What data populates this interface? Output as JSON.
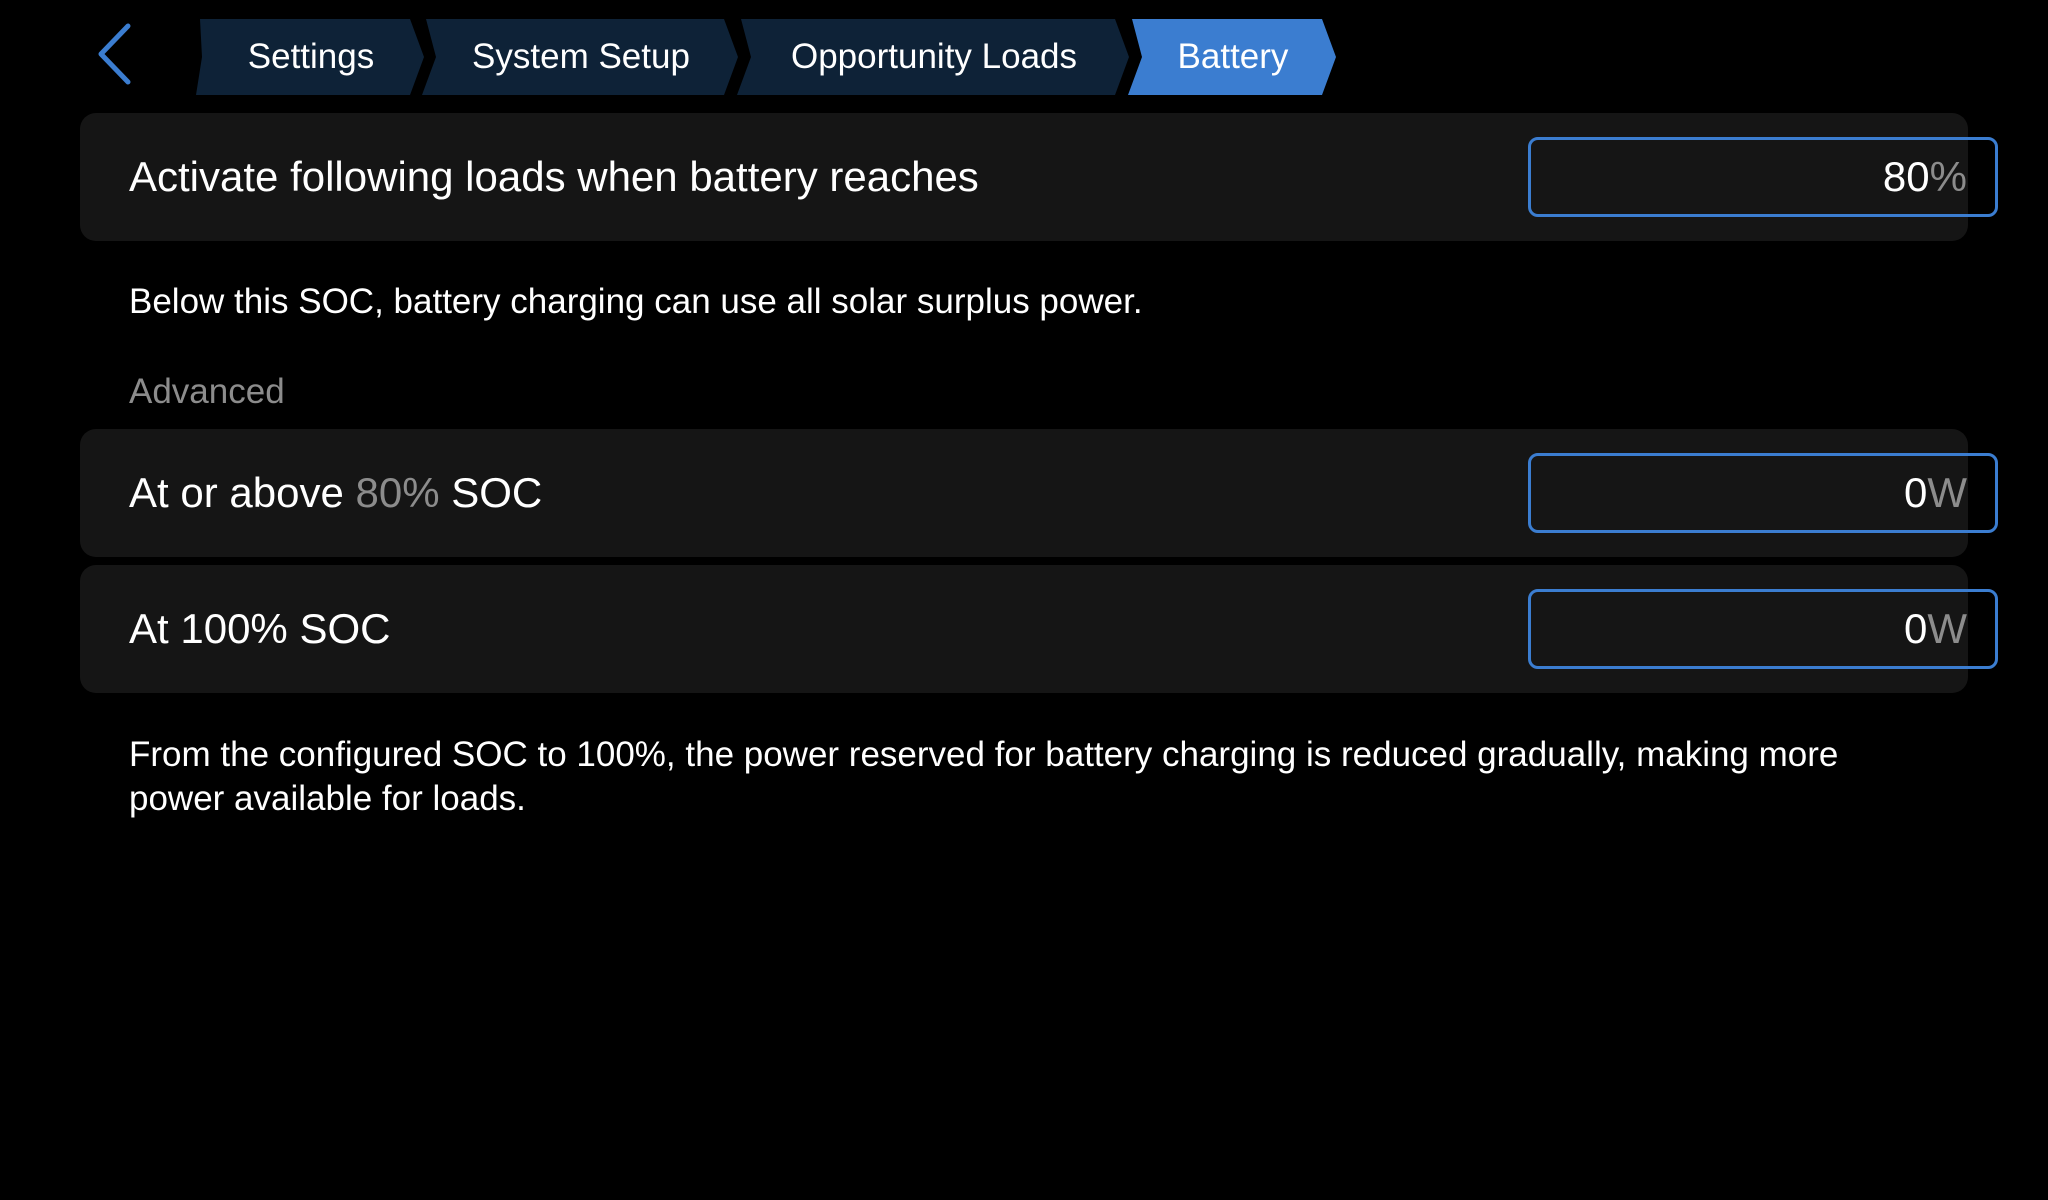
{
  "header": {
    "back_icon": "chevron-left-icon",
    "breadcrumbs": [
      {
        "label": "Settings",
        "active": false
      },
      {
        "label": "System Setup",
        "active": false
      },
      {
        "label": "Opportunity Loads",
        "active": false
      },
      {
        "label": "Battery",
        "active": true
      }
    ]
  },
  "colors": {
    "background": "#000000",
    "card": "#151515",
    "crumb_inactive": "#0e2237",
    "crumb_active": "#3b7dd0",
    "field_border": "#3b7dd0",
    "muted_text": "#8c8c8c"
  },
  "activation": {
    "label": "Activate following loads when battery reaches",
    "value": "80",
    "unit": "%"
  },
  "activation_help": "Below this SOC, battery charging can use all solar surplus power.",
  "advanced": {
    "section_label": "Advanced",
    "rows": [
      {
        "label_prefix": "At or above",
        "label_soc": "80%",
        "label_suffix": "SOC",
        "value": "0",
        "unit": "W"
      },
      {
        "label": "At 100% SOC",
        "value": "0",
        "unit": "W"
      }
    ],
    "help": "From the configured SOC to 100%, the power reserved for battery charging is reduced gradually, making more power available for loads."
  }
}
